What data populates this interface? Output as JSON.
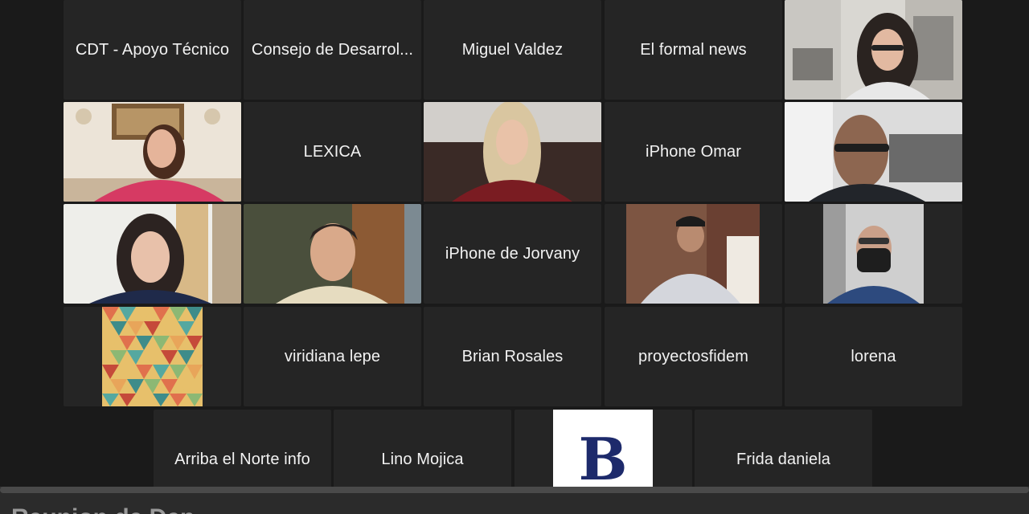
{
  "window": {
    "title": ""
  },
  "participants": [
    {
      "name": "CDT - Apoyo Técnico",
      "video": false
    },
    {
      "name": "Consejo de Desarrol...",
      "video": false
    },
    {
      "name": "Miguel Valdez",
      "video": false
    },
    {
      "name": "El formal news",
      "video": false
    },
    {
      "name": "",
      "video": true,
      "thumbnail": "woman-glasses-office"
    },
    {
      "name": "",
      "video": true,
      "thumbnail": "woman-living-room",
      "active_speaker": true
    },
    {
      "name": "LEXICA",
      "video": false
    },
    {
      "name": "",
      "video": true,
      "thumbnail": "woman-blonde-red-sweater"
    },
    {
      "name": "iPhone Omar",
      "video": false
    },
    {
      "name": "",
      "video": true,
      "thumbnail": "man-bald-glasses"
    },
    {
      "name": "",
      "video": true,
      "thumbnail": "woman-dark-hair-blazer"
    },
    {
      "name": "",
      "video": true,
      "thumbnail": "young-man-beige-hoodie"
    },
    {
      "name": "iPhone de Jorvany",
      "video": false
    },
    {
      "name": "",
      "video": true,
      "thumbnail": "man-cap-shirt-brick-wall"
    },
    {
      "name": "",
      "video": true,
      "thumbnail": "man-mask-car"
    },
    {
      "name": "",
      "video": true,
      "thumbnail": "triangle-pattern-avatar"
    },
    {
      "name": "viridiana lepe",
      "video": false
    },
    {
      "name": "Brian Rosales",
      "video": false
    },
    {
      "name": "proyectosfidem",
      "video": false
    },
    {
      "name": "lorena",
      "video": false
    },
    {
      "name": "Arriba el Norte info",
      "video": false
    },
    {
      "name": "Lino Mojica",
      "video": false
    },
    {
      "name": "",
      "video": true,
      "thumbnail": "letter-b-logo",
      "logo_letter": "B"
    },
    {
      "name": "Frida daniela",
      "video": false
    }
  ],
  "bottom_overlay": {
    "text": "Reunion de Dep..."
  },
  "colors": {
    "background": "#1a1a1a",
    "tile": "#252525",
    "active_border": "#6fbf4f",
    "name_text": "#f2f2f2",
    "logo_blue": "#1d2a6b"
  }
}
